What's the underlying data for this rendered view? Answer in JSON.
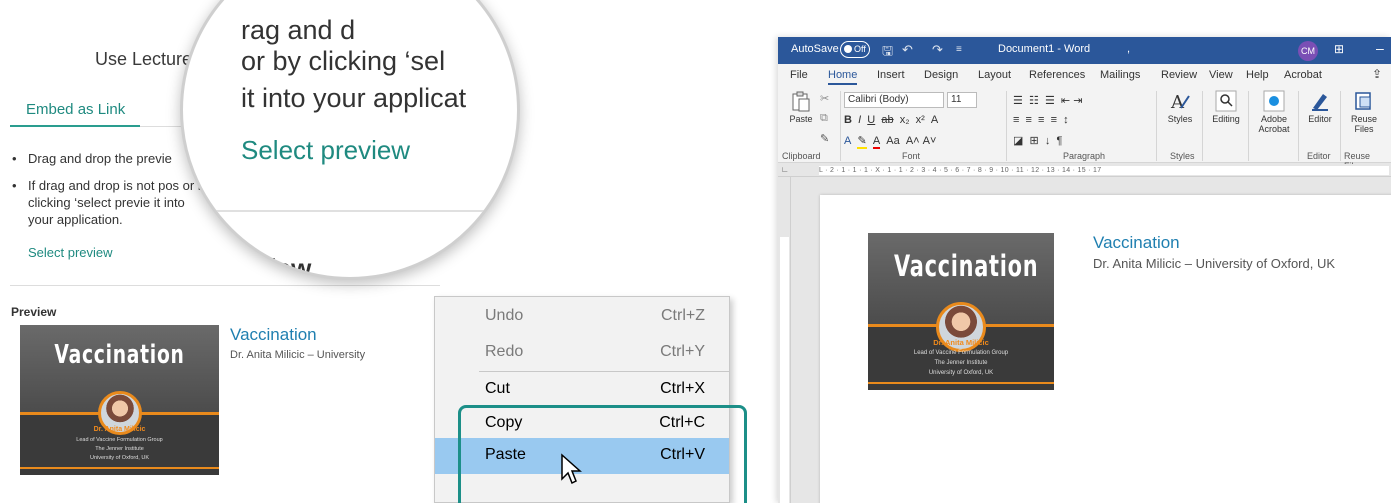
{
  "web": {
    "heading": "Use Lecture in",
    "tabs": [
      "Embed as Link"
    ],
    "bullets": [
      "Drag and drop the previe",
      "If drag and drop is not pos or by clicking ‘select previe it into your application."
    ],
    "select_link": "Select preview",
    "preview_heading": "Preview",
    "card": {
      "title": "Vaccination",
      "subtitle": "Dr. Anita Milicic – University"
    }
  },
  "thumbnail": {
    "title": "Vaccination",
    "name": "Dr. Anita Milicic",
    "lines": [
      "Lead of Vaccine Formulation Group",
      "The Jenner Institute",
      "University of Oxford, UK"
    ]
  },
  "magnifier": {
    "line1": "rag and d",
    "line2": "or by clicking ‘sel",
    "line3": "it into your applicat",
    "select": "Select preview",
    "preview": "Preview"
  },
  "context_menu": {
    "items": [
      {
        "label": "Undo",
        "shortcut": "Ctrl+Z",
        "enabled": false
      },
      {
        "label": "Redo",
        "shortcut": "Ctrl+Y",
        "enabled": false
      },
      {
        "label": "Cut",
        "shortcut": "Ctrl+X",
        "enabled": true
      },
      {
        "label": "Copy",
        "shortcut": "Ctrl+C",
        "enabled": true
      },
      {
        "label": "Paste",
        "shortcut": "Ctrl+V",
        "enabled": true,
        "highlighted": true
      }
    ]
  },
  "word": {
    "titlebar": {
      "autosave": "AutoSave",
      "toggle": "Off",
      "doc_title": "Document1 - Word",
      "comma": ",",
      "user": "CM"
    },
    "menu": [
      "File",
      "Home",
      "Insert",
      "Design",
      "Layout",
      "References",
      "Mailings",
      "Review",
      "View",
      "Help",
      "Acrobat"
    ],
    "ribbon": {
      "paste": "Paste",
      "font_name": "Calibri (Body)",
      "font_size": "11",
      "styles": "Styles",
      "editing": "Editing",
      "adobe": "Adobe Acrobat",
      "editor": "Editor",
      "reuse": "Reuse Files",
      "groups": [
        "Clipboard",
        "Font",
        "Paragraph",
        "Styles",
        "Editor",
        "Reuse Files"
      ]
    },
    "ruler_text": "L · 2 · 1 · 1 · 1 · X · 1 · 1 · 2 · 3 · 4 · 5 · 6 · 7 · 8 · 9 · 10 · 11 · 12 · 13 · 14 · 15 · 17",
    "document": {
      "title": "Vaccination",
      "subtitle": "Dr. Anita Milicic – University of Oxford, UK"
    }
  },
  "colors": {
    "teal": "#1f8a80",
    "word_blue": "#2b579a",
    "link_blue": "#1f7fb0",
    "orange": "#e98a1c",
    "paste_highlight": "#99c9f0"
  }
}
